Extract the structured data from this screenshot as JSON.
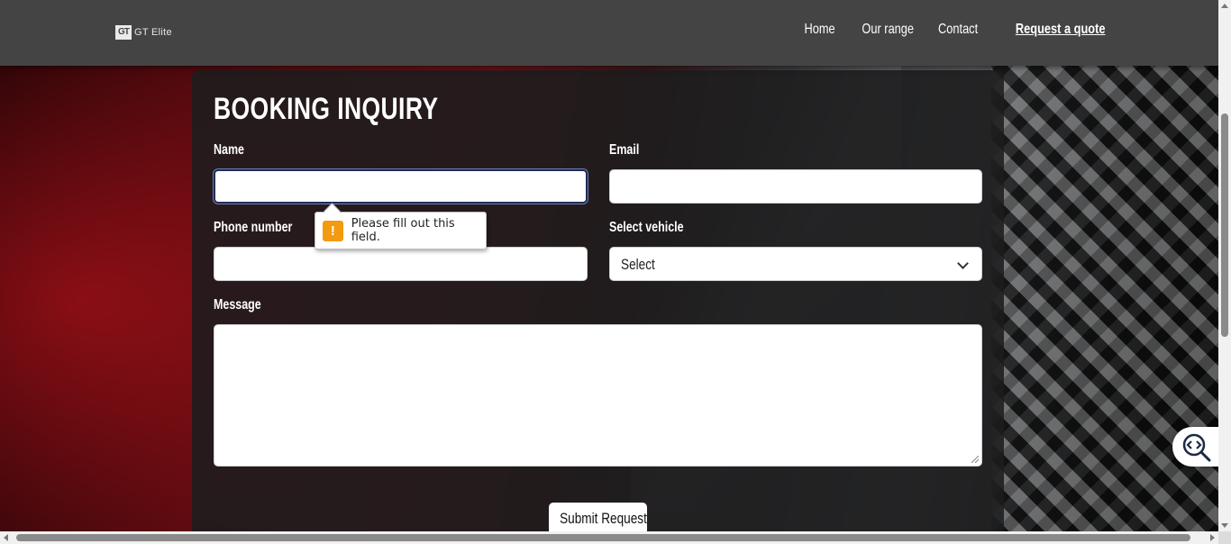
{
  "header": {
    "logo_mark": "GT",
    "logo_text": "GT Elite",
    "nav": [
      "Home",
      "Our range",
      "Contact",
      "Request a quote"
    ]
  },
  "form": {
    "title": "BOOKING INQUIRY",
    "name_label": "Name",
    "name_value": "",
    "email_label": "Email",
    "email_value": "",
    "phone_label": "Phone number",
    "phone_value": "",
    "vehicle_label": "Select vehicle",
    "vehicle_selected": "Select",
    "message_label": "Message",
    "message_value": "",
    "submit_label": "Submit Request"
  },
  "validation": {
    "icon": "!",
    "message": "Please fill out this field."
  },
  "widget": {
    "icon": "code-search-icon"
  }
}
